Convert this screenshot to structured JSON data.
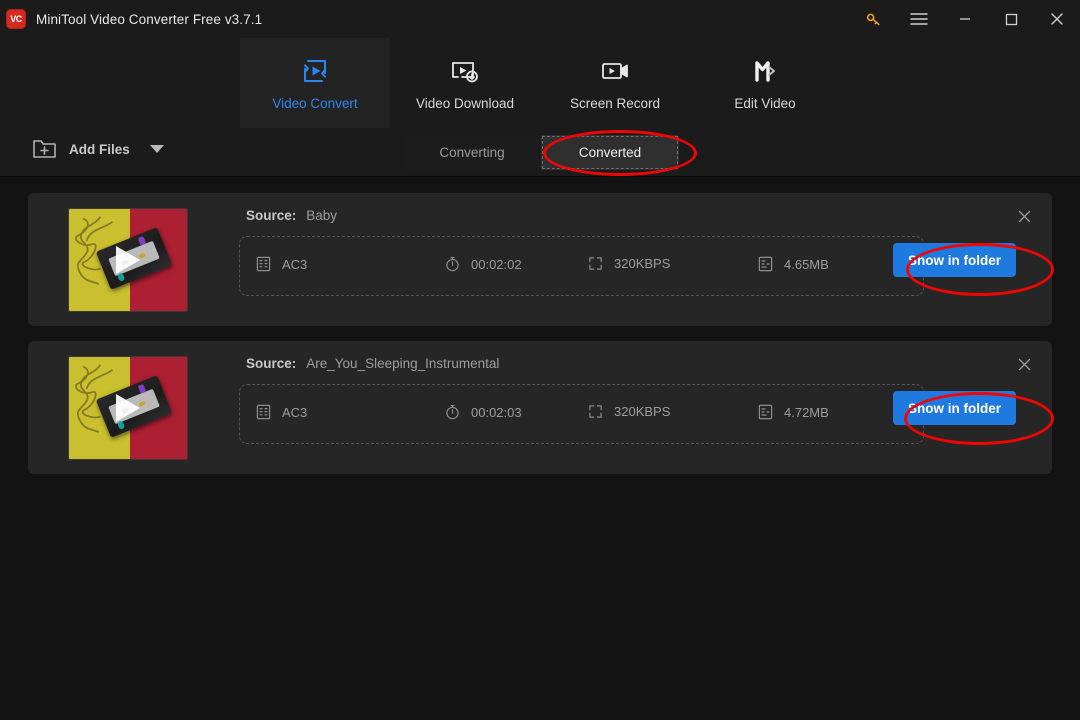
{
  "window": {
    "title": "MiniTool Video Converter Free v3.7.1",
    "logo_text": "VC",
    "controls": [
      {
        "name": "key-icon",
        "glyph": "⚷"
      },
      {
        "name": "menu-icon",
        "glyph": "☰"
      },
      {
        "name": "minimize-icon",
        "glyph": "–"
      },
      {
        "name": "maximize-icon",
        "glyph": "□"
      },
      {
        "name": "close-icon",
        "glyph": "✕"
      }
    ]
  },
  "nav": {
    "tabs": [
      {
        "label": "Video Convert",
        "icon": "video-convert-icon",
        "active": true
      },
      {
        "label": "Video Download",
        "icon": "video-download-icon",
        "active": false
      },
      {
        "label": "Screen Record",
        "icon": "screen-record-icon",
        "active": false
      },
      {
        "label": "Edit Video",
        "icon": "edit-video-icon",
        "active": false
      }
    ],
    "active_color": "#2d86ef"
  },
  "toolbar": {
    "add_files_label": "Add Files",
    "add_files_icon": "folder-plus-icon",
    "dropdown_icon": "chevron-down-icon"
  },
  "segment_tabs": {
    "items": [
      {
        "label": "Converting",
        "active": false
      },
      {
        "label": "Converted",
        "active": true
      }
    ]
  },
  "files": [
    {
      "source_key": "Source:",
      "source_value": "Baby",
      "format": "AC3",
      "duration": "00:02:02",
      "bitrate": "320KBPS",
      "size": "4.65MB",
      "action_label": "Show in folder",
      "close_icon": "close-icon"
    },
    {
      "source_key": "Source:",
      "source_value": "Are_You_Sleeping_Instrumental",
      "format": "AC3",
      "duration": "00:02:03",
      "bitrate": "320KBPS",
      "size": "4.72MB",
      "action_label": "Show in folder",
      "close_icon": "close-icon"
    }
  ],
  "meta_icons": {
    "format": "file-format-icon",
    "duration": "stopwatch-icon",
    "bitrate": "resolution-icon",
    "size": "file-size-icon"
  },
  "annotations": {
    "color": "#f00505",
    "shapes": [
      "ellipse-around-converted-tab",
      "ellipse-around-show-in-folder-1",
      "ellipse-around-show-in-folder-2"
    ]
  },
  "colors": {
    "accent_blue": "#1f7ae0",
    "active_tab_blue": "#2d86ef",
    "key_orange": "#f0a11e",
    "card_bg": "#262626",
    "app_bg": "#131313",
    "chrome_bg": "#1b1b1b",
    "annotation_red": "#f00505"
  }
}
